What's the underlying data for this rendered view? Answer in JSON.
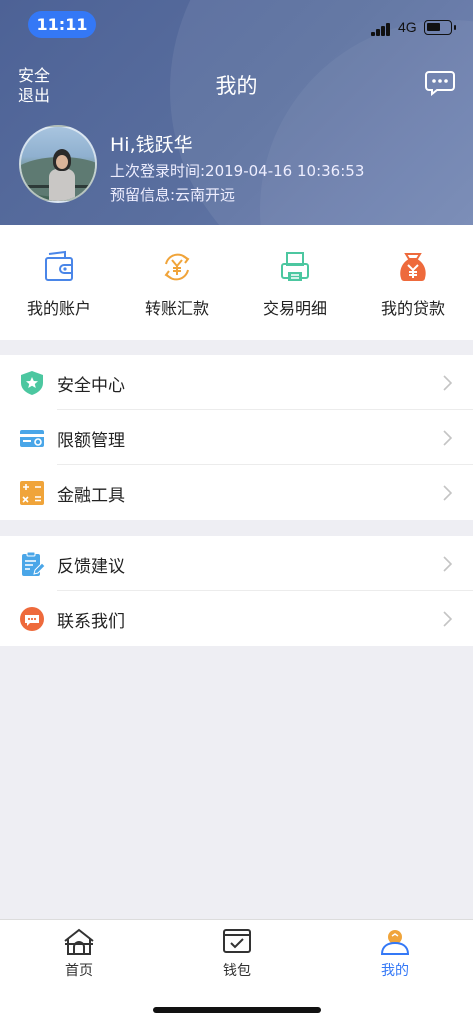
{
  "status_bar": {
    "time": "11:11",
    "network": "4G"
  },
  "header": {
    "logout_label": "安全退出",
    "title": "我的",
    "message_icon": "chat-bubble-icon"
  },
  "profile": {
    "greeting": "Hi,钱跃华",
    "last_login": "上次登录时间:2019-04-16 10:36:53",
    "reserved_info": "预留信息:云南开远"
  },
  "quick_actions": [
    {
      "label": "我的账户",
      "icon": "wallet-icon",
      "color": "#4a86e8"
    },
    {
      "label": "转账汇款",
      "icon": "yuan-transfer-icon",
      "color": "#f0a43a"
    },
    {
      "label": "交易明细",
      "icon": "printer-icon",
      "color": "#4cc7a0"
    },
    {
      "label": "我的贷款",
      "icon": "money-bag-icon",
      "color": "#ee6a3c"
    }
  ],
  "menu_group_1": [
    {
      "label": "安全中心",
      "icon": "shield-icon",
      "color": "#4cc7a0"
    },
    {
      "label": "限额管理",
      "icon": "card-settings-icon",
      "color": "#4aa6e8"
    },
    {
      "label": "金融工具",
      "icon": "calculator-icon",
      "color": "#f0a43a"
    }
  ],
  "menu_group_2": [
    {
      "label": "反馈建议",
      "icon": "clipboard-edit-icon",
      "color": "#4aa6e8"
    },
    {
      "label": "联系我们",
      "icon": "chat-circle-icon",
      "color": "#ee6a3c"
    }
  ],
  "tabbar": [
    {
      "label": "首页",
      "icon": "home-icon",
      "active": false
    },
    {
      "label": "钱包",
      "icon": "wallet-check-icon",
      "active": false
    },
    {
      "label": "我的",
      "icon": "user-icon",
      "active": true
    }
  ],
  "colors": {
    "header": "#5a6f9f",
    "accent": "#3478f6",
    "background": "#eeeef3"
  }
}
